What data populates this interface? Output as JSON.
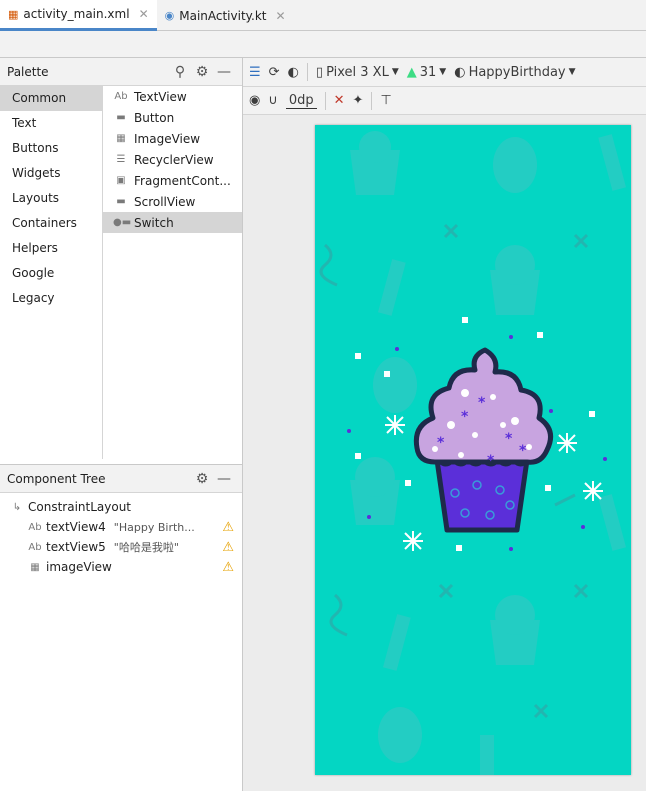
{
  "tabs": [
    {
      "label": "activity_main.xml",
      "active": true
    },
    {
      "label": "MainActivity.kt",
      "active": false
    }
  ],
  "palette": {
    "title": "Palette",
    "categories": [
      "Common",
      "Text",
      "Buttons",
      "Widgets",
      "Layouts",
      "Containers",
      "Helpers",
      "Google",
      "Legacy"
    ],
    "selected_category": "Common",
    "items": [
      {
        "label": "TextView",
        "icon": "textview-icon"
      },
      {
        "label": "Button",
        "icon": "button-icon"
      },
      {
        "label": "ImageView",
        "icon": "imageview-icon"
      },
      {
        "label": "RecyclerView",
        "icon": "recyclerview-icon"
      },
      {
        "label": "FragmentCont...",
        "icon": "fragment-icon"
      },
      {
        "label": "ScrollView",
        "icon": "scrollview-icon"
      },
      {
        "label": "Switch",
        "icon": "switch-icon"
      }
    ],
    "selected_item": "Switch"
  },
  "component_tree": {
    "title": "Component Tree",
    "root": "ConstraintLayout",
    "children": [
      {
        "name": "textView4",
        "value": "\"Happy Birth...",
        "warning": true
      },
      {
        "name": "textView5",
        "value": "\"哈哈是我啦\"",
        "warning": true
      },
      {
        "name": "imageView",
        "value": "",
        "warning": true
      }
    ]
  },
  "toolbar": {
    "device": "Pixel 3 XL",
    "api": "31",
    "theme": "HappyBirthday",
    "margin": "0dp"
  },
  "colors": {
    "background": "#04d6c3",
    "cupcake_frosting": "#c8a4e0",
    "cupcake_base": "#5b2fd9",
    "accent": "#4a86c8",
    "warning": "#e6a100"
  }
}
